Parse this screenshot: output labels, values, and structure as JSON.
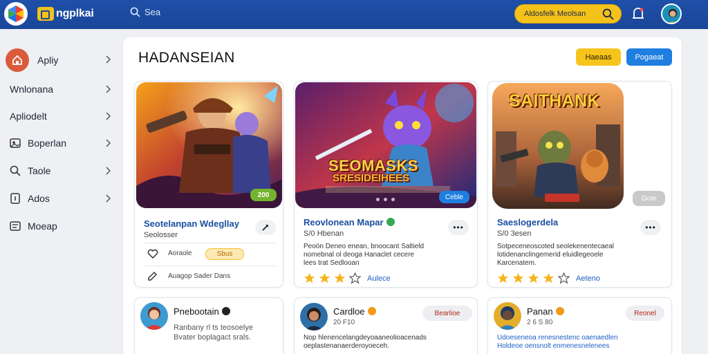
{
  "header": {
    "brand": "ngplkai",
    "search_text": "Sea",
    "search_pill_text": "Aldosfelk Meolsan"
  },
  "sidebar": {
    "items": [
      {
        "label": "Apliy",
        "icon": "home-icon"
      },
      {
        "label": "Wnlonana",
        "icon": ""
      },
      {
        "label": "Apliodelt",
        "icon": ""
      },
      {
        "label": "Boperlan",
        "icon": "gallery-icon"
      },
      {
        "label": "Taole",
        "icon": "search-icon"
      },
      {
        "label": "Ados",
        "icon": "badge-icon"
      },
      {
        "label": "Moeap",
        "icon": "list-icon"
      }
    ]
  },
  "main": {
    "title": "HADANSEIAN",
    "btn_yellow": "Haeaas",
    "btn_blue": "Pogaeat"
  },
  "cards": [
    {
      "title": "Seotelanpan Wdegllay",
      "subtitle": "Seolosser",
      "badge": "200",
      "row1_label": "Aoraole",
      "row1_tag": "Sbus",
      "row2_label": "Auagop Sader Dans"
    },
    {
      "art_title_1": "SEOMASKS",
      "art_title_2": "SRESIDEIHEES",
      "badge": "Ceble",
      "title": "Reovlonean Mapar",
      "subtitle": "S/0 Hbenan",
      "desc_lines": [
        "Peoön Deneo enean, bnoocant Saltield",
        "nomebnal ol deoga Hanaclet cecere",
        "lees trat Sedlooan"
      ],
      "rating": "Aulece"
    },
    {
      "art_title": "SAITHANK",
      "badge": "Gote",
      "title": "Saeslogerdela",
      "subtitle": "S/0 3esen",
      "desc_lines": [
        "Sotpeceneoscoted seolekenentecaeal",
        "lotidenanclingemerid eluidlegeoele",
        "Karcenatem."
      ],
      "rating": "Aeteno"
    }
  ],
  "users": [
    {
      "name": "Pnebootain",
      "meta_lines": [
        "Ranbany rl ts teosoelye",
        "Bvater boplagact srals."
      ]
    },
    {
      "name": "Cardloe",
      "meta": "20 F10",
      "follow": "Bearlioe",
      "desc": [
        "Nop hlenencelangdeyoaaneolioacenads",
        "oeplastenanaerderoyoeceh."
      ]
    },
    {
      "name": "Panan",
      "meta": "2 6 S 80",
      "follow": "Reonel",
      "desc": [
        "Udoeseneoa renesnestenc oaenaedlen",
        "Holdeoe oensnolt enmenesnelenees"
      ]
    }
  ],
  "colors": {
    "header": "#1a4699",
    "accent_yellow": "#f6c41c",
    "accent_blue": "#1f7ee0",
    "link_blue": "#1a4fa0"
  }
}
